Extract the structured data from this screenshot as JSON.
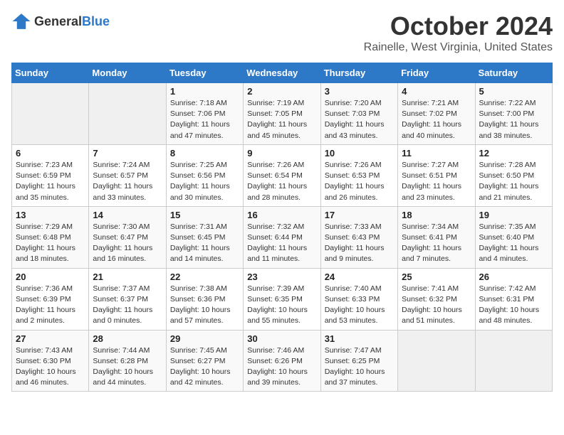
{
  "header": {
    "logo_general": "General",
    "logo_blue": "Blue",
    "month_title": "October 2024",
    "location": "Rainelle, West Virginia, United States"
  },
  "days_of_week": [
    "Sunday",
    "Monday",
    "Tuesday",
    "Wednesday",
    "Thursday",
    "Friday",
    "Saturday"
  ],
  "weeks": [
    [
      {
        "day": "",
        "empty": true
      },
      {
        "day": "",
        "empty": true
      },
      {
        "day": "1",
        "sunrise": "Sunrise: 7:18 AM",
        "sunset": "Sunset: 7:06 PM",
        "daylight": "Daylight: 11 hours and 47 minutes."
      },
      {
        "day": "2",
        "sunrise": "Sunrise: 7:19 AM",
        "sunset": "Sunset: 7:05 PM",
        "daylight": "Daylight: 11 hours and 45 minutes."
      },
      {
        "day": "3",
        "sunrise": "Sunrise: 7:20 AM",
        "sunset": "Sunset: 7:03 PM",
        "daylight": "Daylight: 11 hours and 43 minutes."
      },
      {
        "day": "4",
        "sunrise": "Sunrise: 7:21 AM",
        "sunset": "Sunset: 7:02 PM",
        "daylight": "Daylight: 11 hours and 40 minutes."
      },
      {
        "day": "5",
        "sunrise": "Sunrise: 7:22 AM",
        "sunset": "Sunset: 7:00 PM",
        "daylight": "Daylight: 11 hours and 38 minutes."
      }
    ],
    [
      {
        "day": "6",
        "sunrise": "Sunrise: 7:23 AM",
        "sunset": "Sunset: 6:59 PM",
        "daylight": "Daylight: 11 hours and 35 minutes."
      },
      {
        "day": "7",
        "sunrise": "Sunrise: 7:24 AM",
        "sunset": "Sunset: 6:57 PM",
        "daylight": "Daylight: 11 hours and 33 minutes."
      },
      {
        "day": "8",
        "sunrise": "Sunrise: 7:25 AM",
        "sunset": "Sunset: 6:56 PM",
        "daylight": "Daylight: 11 hours and 30 minutes."
      },
      {
        "day": "9",
        "sunrise": "Sunrise: 7:26 AM",
        "sunset": "Sunset: 6:54 PM",
        "daylight": "Daylight: 11 hours and 28 minutes."
      },
      {
        "day": "10",
        "sunrise": "Sunrise: 7:26 AM",
        "sunset": "Sunset: 6:53 PM",
        "daylight": "Daylight: 11 hours and 26 minutes."
      },
      {
        "day": "11",
        "sunrise": "Sunrise: 7:27 AM",
        "sunset": "Sunset: 6:51 PM",
        "daylight": "Daylight: 11 hours and 23 minutes."
      },
      {
        "day": "12",
        "sunrise": "Sunrise: 7:28 AM",
        "sunset": "Sunset: 6:50 PM",
        "daylight": "Daylight: 11 hours and 21 minutes."
      }
    ],
    [
      {
        "day": "13",
        "sunrise": "Sunrise: 7:29 AM",
        "sunset": "Sunset: 6:48 PM",
        "daylight": "Daylight: 11 hours and 18 minutes."
      },
      {
        "day": "14",
        "sunrise": "Sunrise: 7:30 AM",
        "sunset": "Sunset: 6:47 PM",
        "daylight": "Daylight: 11 hours and 16 minutes."
      },
      {
        "day": "15",
        "sunrise": "Sunrise: 7:31 AM",
        "sunset": "Sunset: 6:45 PM",
        "daylight": "Daylight: 11 hours and 14 minutes."
      },
      {
        "day": "16",
        "sunrise": "Sunrise: 7:32 AM",
        "sunset": "Sunset: 6:44 PM",
        "daylight": "Daylight: 11 hours and 11 minutes."
      },
      {
        "day": "17",
        "sunrise": "Sunrise: 7:33 AM",
        "sunset": "Sunset: 6:43 PM",
        "daylight": "Daylight: 11 hours and 9 minutes."
      },
      {
        "day": "18",
        "sunrise": "Sunrise: 7:34 AM",
        "sunset": "Sunset: 6:41 PM",
        "daylight": "Daylight: 11 hours and 7 minutes."
      },
      {
        "day": "19",
        "sunrise": "Sunrise: 7:35 AM",
        "sunset": "Sunset: 6:40 PM",
        "daylight": "Daylight: 11 hours and 4 minutes."
      }
    ],
    [
      {
        "day": "20",
        "sunrise": "Sunrise: 7:36 AM",
        "sunset": "Sunset: 6:39 PM",
        "daylight": "Daylight: 11 hours and 2 minutes."
      },
      {
        "day": "21",
        "sunrise": "Sunrise: 7:37 AM",
        "sunset": "Sunset: 6:37 PM",
        "daylight": "Daylight: 11 hours and 0 minutes."
      },
      {
        "day": "22",
        "sunrise": "Sunrise: 7:38 AM",
        "sunset": "Sunset: 6:36 PM",
        "daylight": "Daylight: 10 hours and 57 minutes."
      },
      {
        "day": "23",
        "sunrise": "Sunrise: 7:39 AM",
        "sunset": "Sunset: 6:35 PM",
        "daylight": "Daylight: 10 hours and 55 minutes."
      },
      {
        "day": "24",
        "sunrise": "Sunrise: 7:40 AM",
        "sunset": "Sunset: 6:33 PM",
        "daylight": "Daylight: 10 hours and 53 minutes."
      },
      {
        "day": "25",
        "sunrise": "Sunrise: 7:41 AM",
        "sunset": "Sunset: 6:32 PM",
        "daylight": "Daylight: 10 hours and 51 minutes."
      },
      {
        "day": "26",
        "sunrise": "Sunrise: 7:42 AM",
        "sunset": "Sunset: 6:31 PM",
        "daylight": "Daylight: 10 hours and 48 minutes."
      }
    ],
    [
      {
        "day": "27",
        "sunrise": "Sunrise: 7:43 AM",
        "sunset": "Sunset: 6:30 PM",
        "daylight": "Daylight: 10 hours and 46 minutes."
      },
      {
        "day": "28",
        "sunrise": "Sunrise: 7:44 AM",
        "sunset": "Sunset: 6:28 PM",
        "daylight": "Daylight: 10 hours and 44 minutes."
      },
      {
        "day": "29",
        "sunrise": "Sunrise: 7:45 AM",
        "sunset": "Sunset: 6:27 PM",
        "daylight": "Daylight: 10 hours and 42 minutes."
      },
      {
        "day": "30",
        "sunrise": "Sunrise: 7:46 AM",
        "sunset": "Sunset: 6:26 PM",
        "daylight": "Daylight: 10 hours and 39 minutes."
      },
      {
        "day": "31",
        "sunrise": "Sunrise: 7:47 AM",
        "sunset": "Sunset: 6:25 PM",
        "daylight": "Daylight: 10 hours and 37 minutes."
      },
      {
        "day": "",
        "empty": true
      },
      {
        "day": "",
        "empty": true
      }
    ]
  ]
}
